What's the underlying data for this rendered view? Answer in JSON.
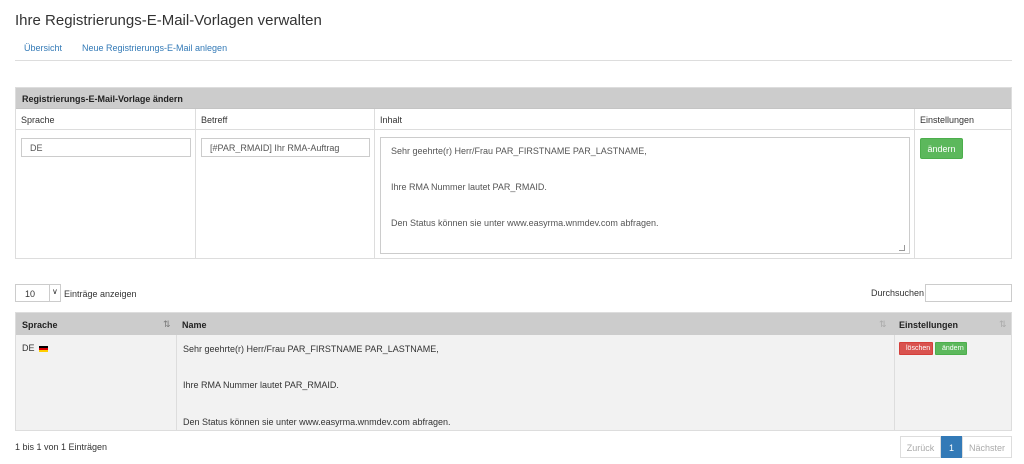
{
  "page": {
    "title": "Ihre Registrierungs-E-Mail-Vorlagen verwalten"
  },
  "nav": {
    "overview": "Übersicht",
    "new_template": "Neue Registrierungs-E-Mail anlegen"
  },
  "edit_panel": {
    "title": "Registrierungs-E-Mail-Vorlage ändern",
    "headers": {
      "language": "Sprache",
      "subject": "Betreff",
      "content": "Inhalt",
      "settings": "Einstellungen"
    },
    "language_value": "DE",
    "subject_value": "[#PAR_RMAID] Ihr RMA-Auftrag",
    "content_value": "Sehr geehrte(r) Herr/Frau PAR_FIRSTNAME PAR_LASTNAME,\n\n\nIhre RMA Nummer lautet PAR_RMAID.\n\n\nDen Status können sie unter www.easyrma.wnmdev.com abfragen.",
    "save_button": "ändern"
  },
  "list_controls": {
    "page_length": "10",
    "page_length_label": "Einträge anzeigen",
    "search_label": "Durchsuchen",
    "search_value": ""
  },
  "table": {
    "headers": {
      "language": "Sprache",
      "name": "Name",
      "settings": "Einstellungen"
    },
    "rows": [
      {
        "language": "DE",
        "flag_colors": [
          "#000000",
          "#dd0000",
          "#ffce00"
        ],
        "name_lines": [
          "Sehr geehrte(r) Herr/Frau PAR_FIRSTNAME PAR_LASTNAME,",
          "Ihre RMA Nummer lautet PAR_RMAID.",
          "Den Status können sie unter www.easyrma.wnmdev.com abfragen."
        ],
        "delete_label": "löschen",
        "edit_label": "ändern"
      }
    ]
  },
  "footer": {
    "info": "1 bis 1 von 1 Einträgen",
    "prev": "Zurück",
    "current_page": "1",
    "next": "Nächster"
  },
  "colors": {
    "primary": "#337ab7",
    "success": "#5cb85c",
    "danger": "#d9534f",
    "header_bg": "#cccccc"
  }
}
